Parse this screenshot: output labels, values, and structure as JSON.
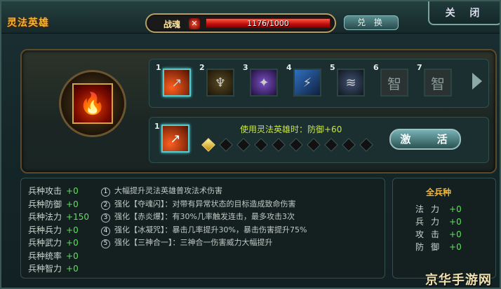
{
  "window": {
    "title": "灵法英雄",
    "close_label": "关 闭",
    "exchange_label": "兑 换"
  },
  "soul": {
    "label": "战魂",
    "icon": "x-soul-icon",
    "current": 1176,
    "max": 1000,
    "text": "1176/1000",
    "fill_fraction": 1.0
  },
  "hero": {
    "name_icon": "hero-portrait-icon"
  },
  "skills": [
    {
      "num": "1",
      "icon": "flame-arrow-icon",
      "selected": true
    },
    {
      "num": "2",
      "icon": "dark-warrior-icon",
      "selected": false
    },
    {
      "num": "3",
      "icon": "purple-aura-icon",
      "selected": false
    },
    {
      "num": "4",
      "icon": "ice-shard-icon",
      "selected": false
    },
    {
      "num": "5",
      "icon": "shadow-swirl-icon",
      "selected": false
    },
    {
      "num": "6",
      "icon": "wisdom-icon",
      "label": "智",
      "selected": false
    },
    {
      "num": "7",
      "icon": "wisdom-icon",
      "label": "智",
      "selected": false
    }
  ],
  "use_panel": {
    "num": "1",
    "text": "使用灵法英雄时：防御+60",
    "gems_total": 10,
    "gems_filled": 1,
    "activate_label": "激 活"
  },
  "stats": [
    {
      "label": "兵种攻击",
      "value": "+0"
    },
    {
      "label": "兵种防御",
      "value": "+0"
    },
    {
      "label": "兵种法力",
      "value": "+150"
    },
    {
      "label": "兵种兵力",
      "value": "+0"
    },
    {
      "label": "兵种武力",
      "value": "+0"
    },
    {
      "label": "兵种统率",
      "value": "+0"
    },
    {
      "label": "兵种智力",
      "value": "+0"
    }
  ],
  "descriptions": [
    {
      "num": "1",
      "text": "大幅提升灵法英雄普攻法术伤害"
    },
    {
      "num": "2",
      "text": "强化【夺魂闪】：对带有异常状态的目标造成致命伤害"
    },
    {
      "num": "3",
      "text": "强化【赤炎爆】：有30%几率触发连击，最多攻击3次"
    },
    {
      "num": "4",
      "text": "强化【冰凝咒】：暴击几率提升30%，暴击伤害提升75%"
    },
    {
      "num": "5",
      "text": "强化【三神合一】：三神合一伤害威力大幅提升"
    }
  ],
  "all_troops": {
    "title": "全兵种",
    "items": [
      {
        "label": "法力",
        "value": "+0"
      },
      {
        "label": "兵力",
        "value": "+0"
      },
      {
        "label": "攻击",
        "value": "+0"
      },
      {
        "label": "防御",
        "value": "+0"
      }
    ]
  },
  "watermark": "京华手游网",
  "colors": {
    "accent": "#f0b830",
    "positive": "#5fe25f",
    "frame": "#58c8cc"
  }
}
